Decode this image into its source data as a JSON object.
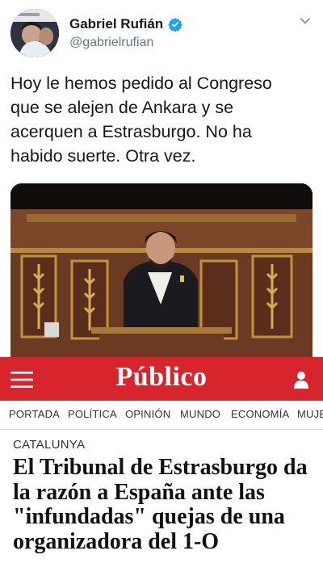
{
  "tweet": {
    "display_name": "Gabriel Rufián",
    "handle": "@gabrielrufian",
    "text": "Hoy le hemos pedido al Congreso\nque se alejen de Ankara y se\nacerquen a Estrasburgo. No ha\nhabido suerte. Otra vez.",
    "icons": {
      "verified": "verified-badge-icon",
      "more": "chevron-down-icon"
    },
    "colors": {
      "verified": "#1da1f2",
      "handle": "#657786"
    }
  },
  "publico": {
    "logo": "Público",
    "bar_color": "#d8242d",
    "nav": [
      "PORTADA",
      "POLÍTICA",
      "OPINIÓN",
      "MUNDO",
      "ECONOMÍA",
      "MUJER"
    ],
    "section": "CATALUNYA",
    "headline": "El Tribunal de Estrasburgo da la razón a España ante las \"infundadas\" quejas de una organizadora del 1-O"
  }
}
